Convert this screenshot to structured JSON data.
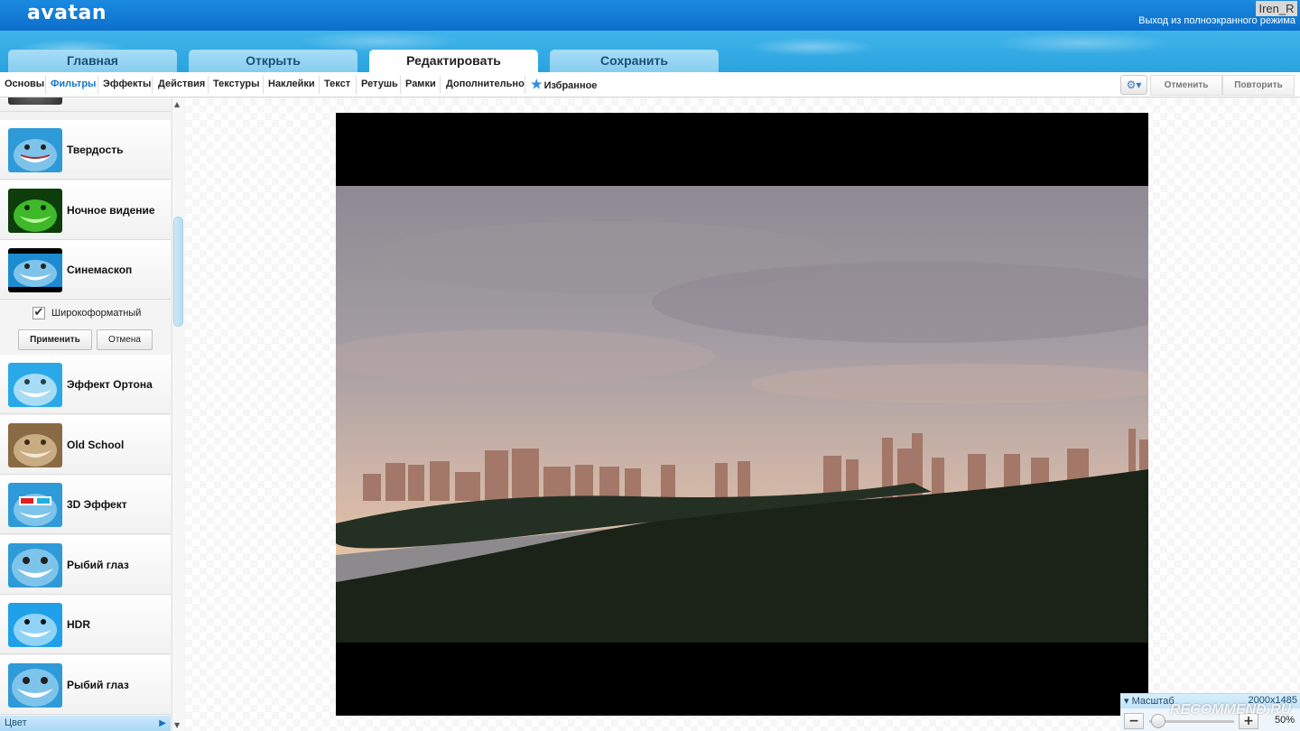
{
  "app": {
    "logo": "avatan",
    "user": "Iren_R",
    "exit_fullscreen": "Выход из полноэкранного режима"
  },
  "tabs": [
    {
      "label": "Главная",
      "active": false
    },
    {
      "label": "Открыть",
      "active": false
    },
    {
      "label": "Редактировать",
      "active": true
    },
    {
      "label": "Сохранить",
      "active": false
    }
  ],
  "submenu": {
    "items": [
      "Основы",
      "Фильтры",
      "Эффекты",
      "Действия",
      "Текстуры",
      "Наклейки",
      "Текст",
      "Ретушь",
      "Рамки",
      "Дополнительно"
    ],
    "active": "Фильтры",
    "favorites": "Избранное",
    "undo": "Отменить",
    "redo": "Повторить",
    "settings_icon": "gear-icon"
  },
  "filters": [
    {
      "label": "Твердость",
      "thumb_color": "#2f9ad8"
    },
    {
      "label": "Ночное видение",
      "thumb_color": "#2e9b1f"
    },
    {
      "label": "Синемаскоп",
      "thumb_color": "#1d8bd0"
    },
    {
      "label": "Эффект Ортона",
      "thumb_color": "#2aa8e8"
    },
    {
      "label": "Old School",
      "thumb_color": "#8a6a45"
    },
    {
      "label": "3D Эффект",
      "thumb_color": "#2f9ad8"
    },
    {
      "label": "Рыбий глаз",
      "thumb_color": "#2f9ad8"
    },
    {
      "label": "HDR",
      "thumb_color": "#1fa0e8"
    },
    {
      "label": "Рыбий глаз",
      "thumb_color": "#2f9ad8"
    }
  ],
  "cinemascope_options": {
    "checkbox_label": "Широкоформатный",
    "checked": true,
    "apply": "Применить",
    "cancel": "Отмена"
  },
  "color_section": "Цвет",
  "zoom": {
    "title": "Масштаб",
    "size": "2000x1485",
    "value": "50%"
  },
  "watermark": "RECOMMEND.RU"
}
